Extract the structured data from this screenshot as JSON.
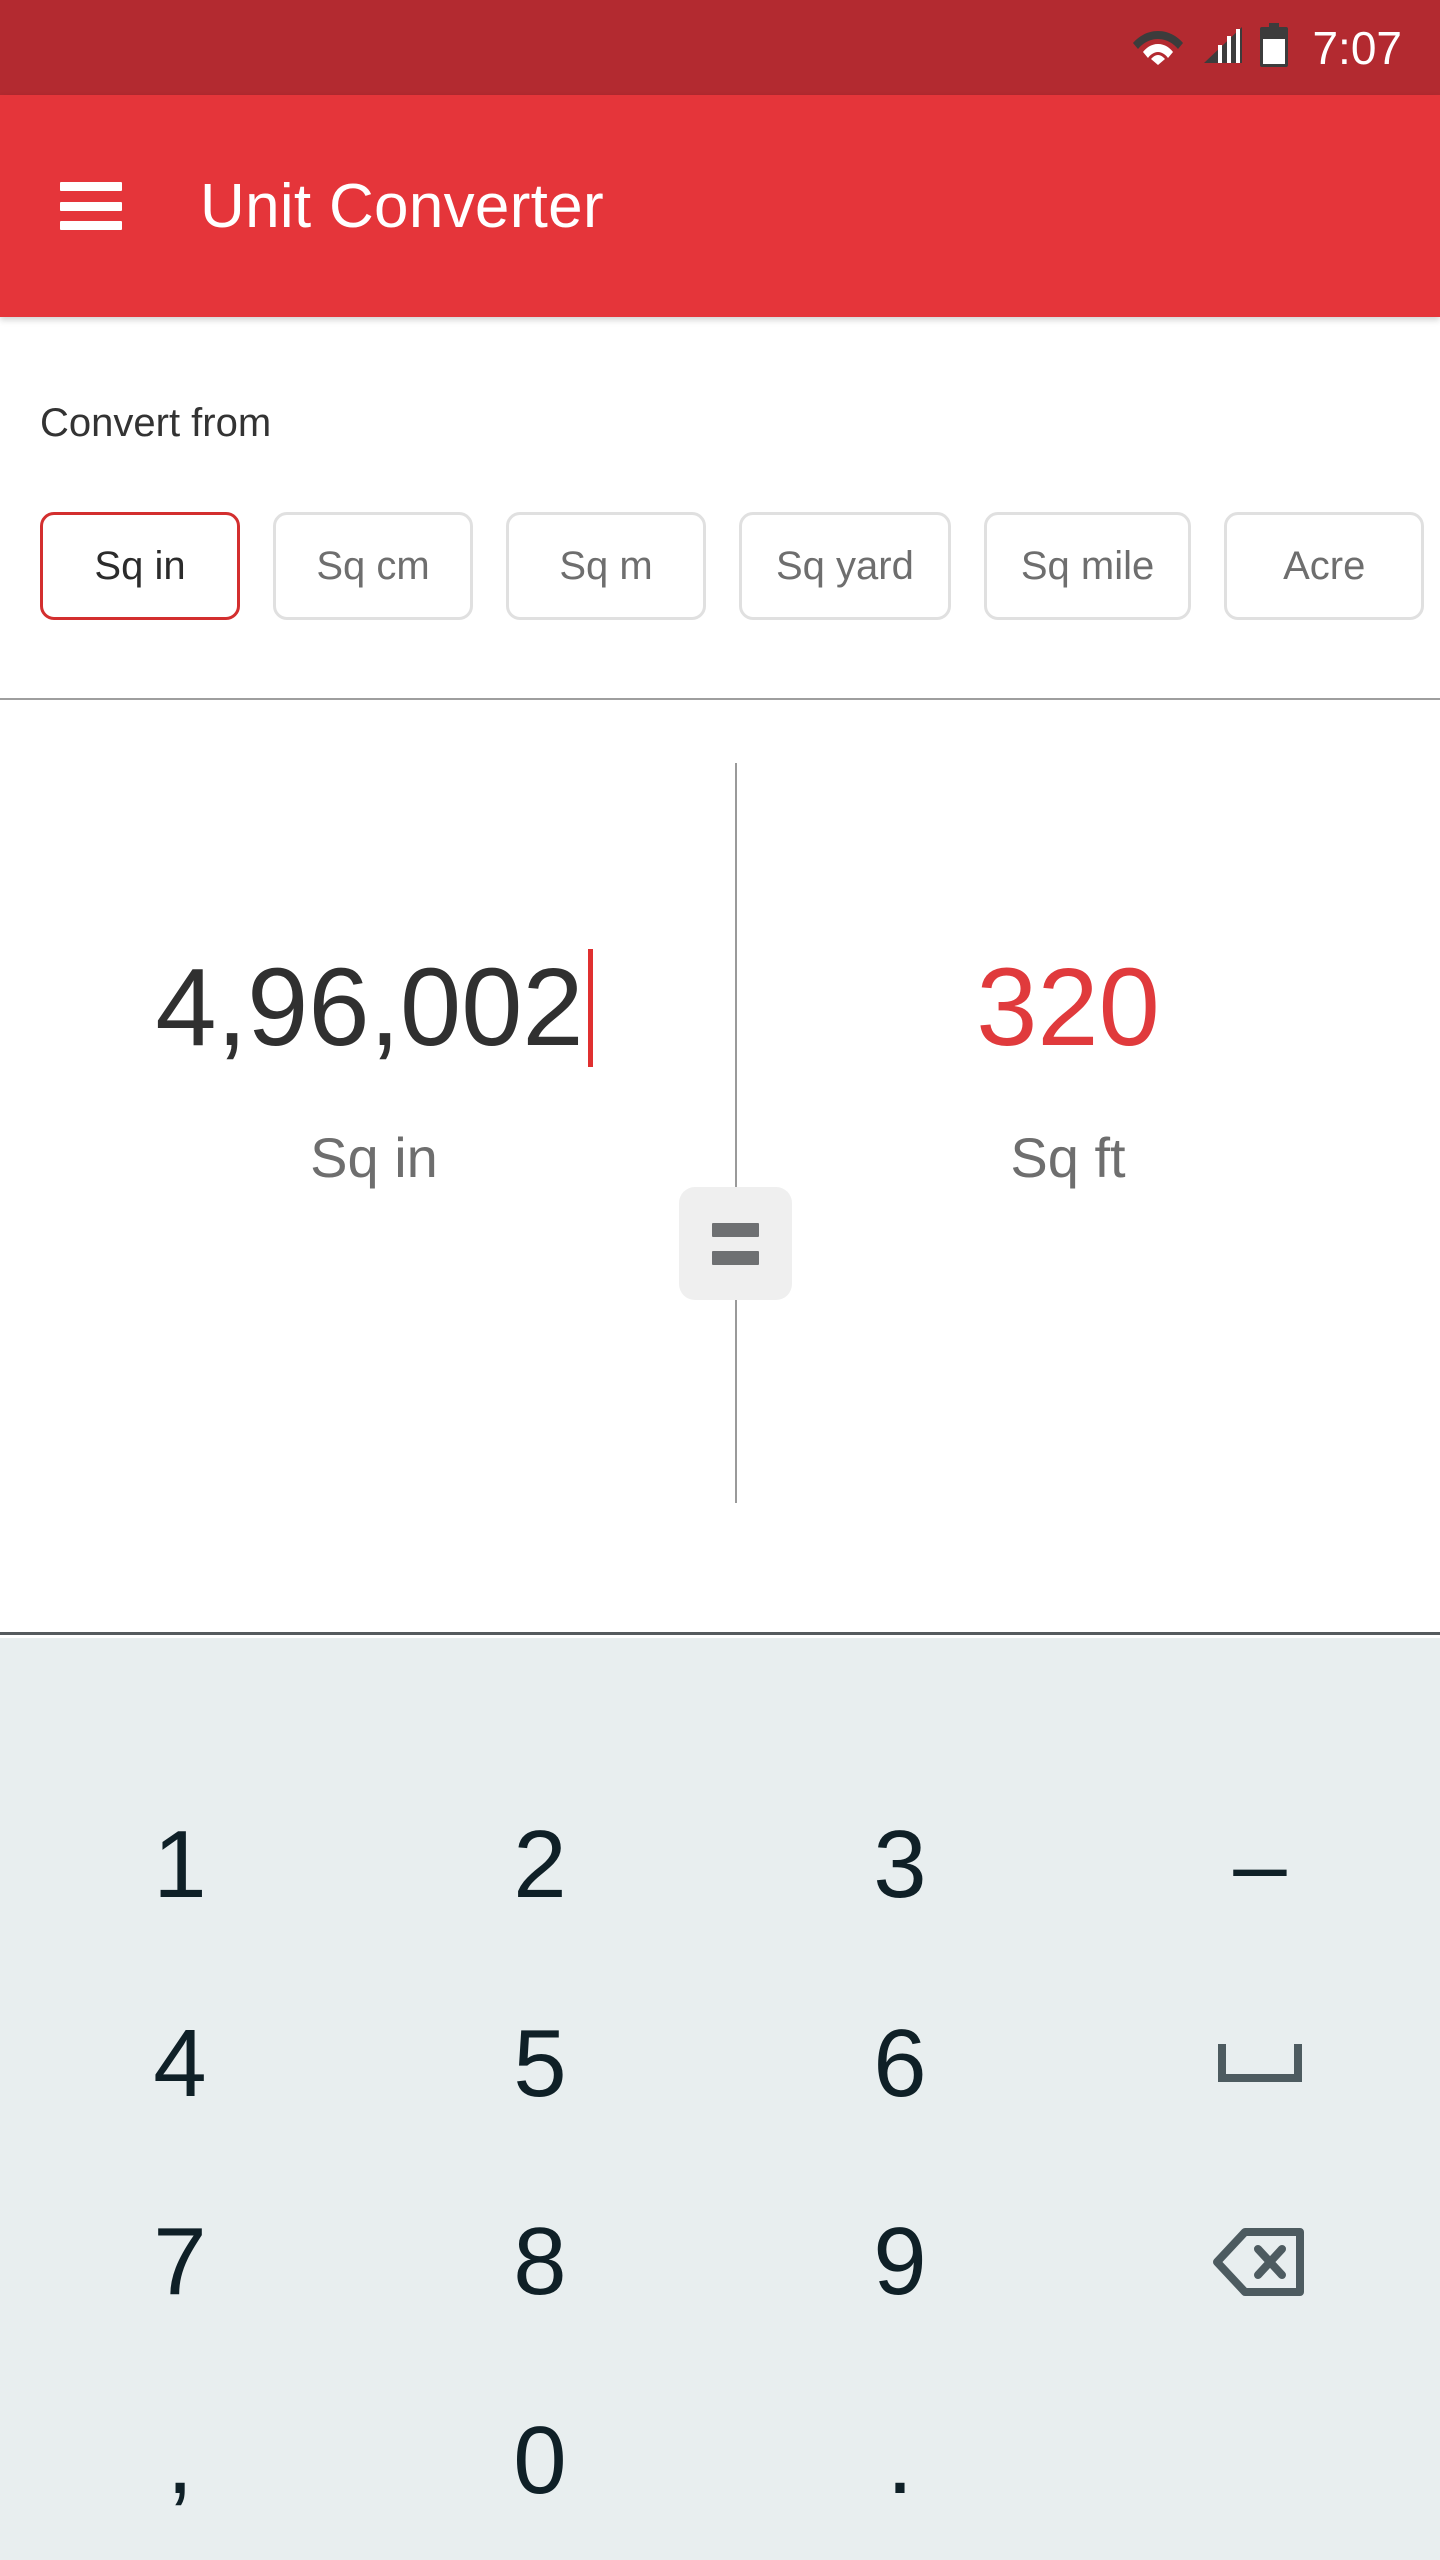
{
  "status_bar": {
    "time": "7:07",
    "background": "#b32a30",
    "icons": [
      "wifi-icon",
      "signal-icon",
      "battery-icon"
    ]
  },
  "app_bar": {
    "title": "Unit Converter",
    "menu_icon": "hamburger-menu-icon",
    "background": "#e5353a"
  },
  "convert_from": {
    "label": "Convert from",
    "selected_unit": "Sq in",
    "selected_border_color": "#d32f2f",
    "chips": [
      {
        "label": "Sq in",
        "selected": true
      },
      {
        "label": "Sq cm",
        "selected": false
      },
      {
        "label": "Sq m",
        "selected": false
      },
      {
        "label": "Sq yard",
        "selected": false
      },
      {
        "label": "Sq mile",
        "selected": false
      },
      {
        "label": "Acre",
        "selected": false
      }
    ]
  },
  "conversion": {
    "input_value": "4,96,002",
    "input_unit": "Sq in",
    "input_color": "#303030",
    "caret_color": "#e03030",
    "result_value": "320",
    "result_unit": "Sq ft",
    "result_color": "#e03a3c",
    "equals_label": "=",
    "equals_icon": "equals-icon"
  },
  "keypad": {
    "background": "#e8eeef",
    "key_color": "#0f2027",
    "keys": [
      {
        "label": "1",
        "name": "key-1",
        "type": "digit"
      },
      {
        "label": "2",
        "name": "key-2",
        "type": "digit"
      },
      {
        "label": "3",
        "name": "key-3",
        "type": "digit"
      },
      {
        "label": "–",
        "name": "key-dash",
        "type": "symbol"
      },
      {
        "label": "4",
        "name": "key-4",
        "type": "digit"
      },
      {
        "label": "5",
        "name": "key-5",
        "type": "digit"
      },
      {
        "label": "6",
        "name": "key-6",
        "type": "digit"
      },
      {
        "label": "",
        "name": "key-space",
        "type": "icon",
        "icon": "space-bar-icon"
      },
      {
        "label": "7",
        "name": "key-7",
        "type": "digit"
      },
      {
        "label": "8",
        "name": "key-8",
        "type": "digit"
      },
      {
        "label": "9",
        "name": "key-9",
        "type": "digit"
      },
      {
        "label": "",
        "name": "key-backspace",
        "type": "icon",
        "icon": "backspace-icon"
      },
      {
        "label": ",",
        "name": "key-comma",
        "type": "symbol"
      },
      {
        "label": "0",
        "name": "key-0",
        "type": "digit"
      },
      {
        "label": ".",
        "name": "key-period",
        "type": "symbol"
      },
      {
        "label": "",
        "name": "key-blank",
        "type": "empty"
      }
    ]
  }
}
